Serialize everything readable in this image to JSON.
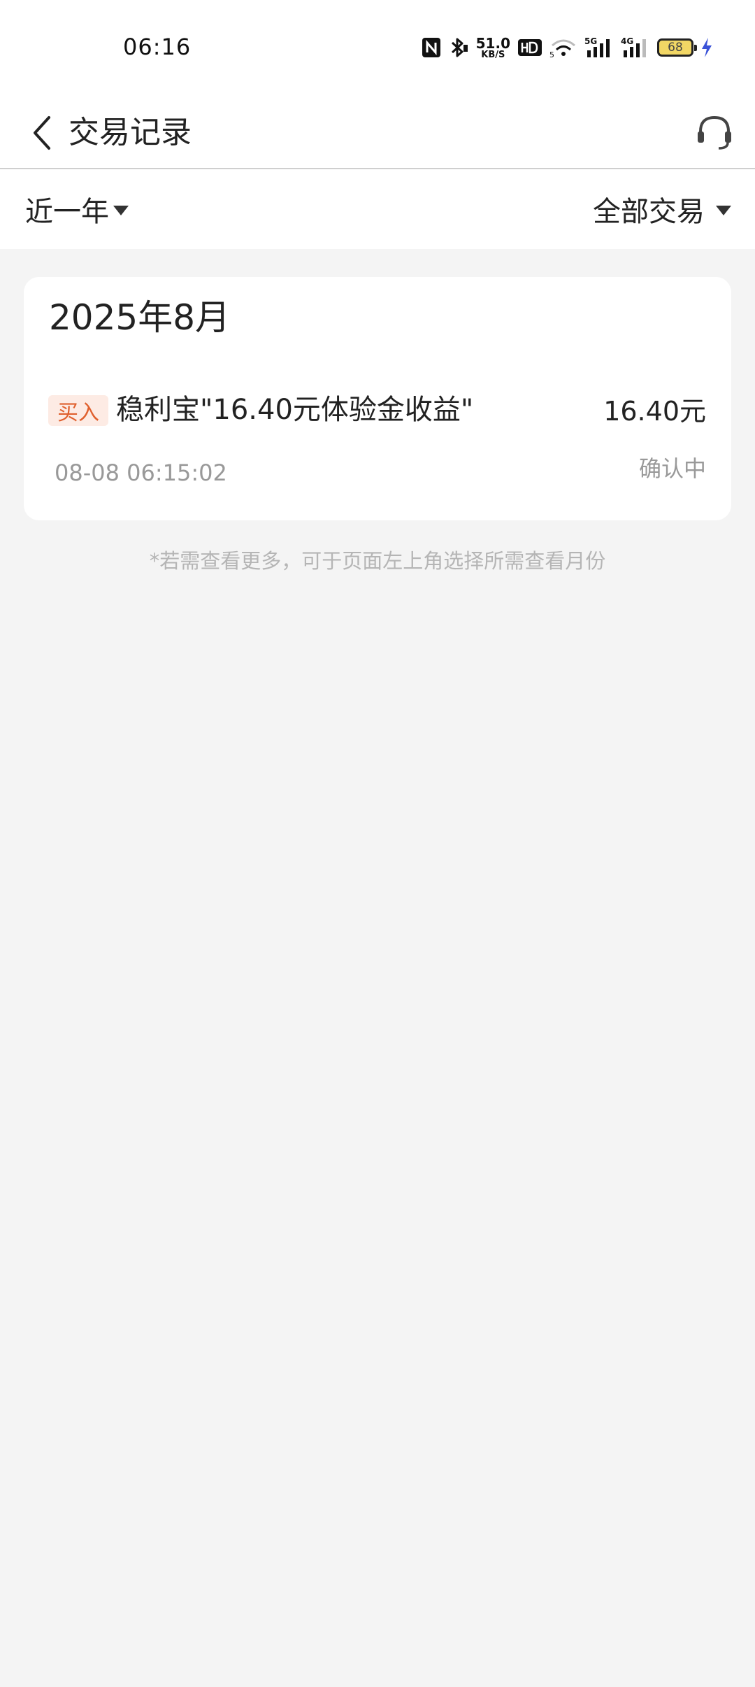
{
  "status_bar": {
    "time": "06:16",
    "net_speed_value": "51.0",
    "net_speed_unit": "KB/S",
    "battery_level": "68",
    "icons": [
      "nfc-icon",
      "bluetooth-icon",
      "hd-icon",
      "wifi-icon",
      "signal-5g-icon",
      "signal-4g-icon",
      "battery-icon",
      "charging-icon"
    ]
  },
  "header": {
    "title": "交易记录",
    "back_icon": "chevron-left-icon",
    "service_icon": "headset-icon"
  },
  "filters": {
    "period": "近一年",
    "type": "全部交易"
  },
  "records": {
    "month": "2025年8月",
    "items": [
      {
        "tag": "买入",
        "name": "稳利宝\"16.40元体验金收益\"",
        "amount": "16.40元",
        "time": "08-08 06:15:02",
        "status": "确认中"
      }
    ]
  },
  "hint": "*若需查看更多，可于页面左上角选择所需查看月份",
  "colors": {
    "background": "#f4f4f4",
    "card": "#ffffff",
    "tag_bg": "#fdebe4",
    "tag_text": "#e0602e",
    "muted_text": "#999999"
  }
}
